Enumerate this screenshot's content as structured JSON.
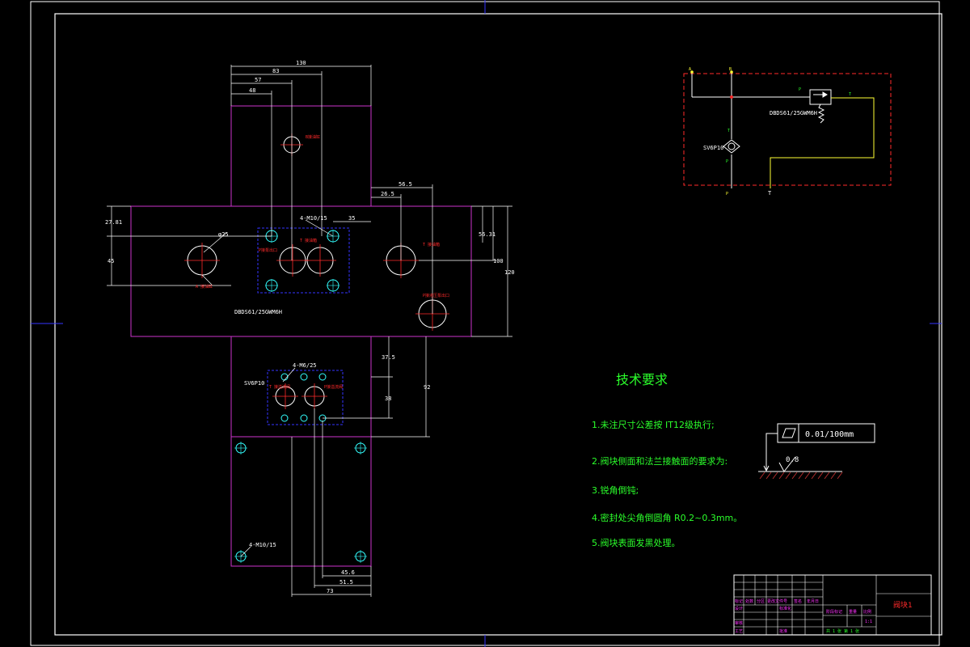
{
  "colors": {
    "background": "#000000",
    "frame": "#ffffff",
    "part_outline": "#cc33cc",
    "dimension": "#ffffff",
    "port_label": "#ff2a2a",
    "bolt_hole": "#33ffff",
    "hidden_rect": "#3333ff",
    "notes": "#2bff2b",
    "schematic_box": "#ff2a2a",
    "schematic_line": "#ffff33",
    "axis_marker": "#3333ff"
  },
  "dimensions": {
    "d130": "130",
    "d83": "83",
    "d57": "57",
    "d48": "48",
    "d565": "56.5",
    "d265": "26.5",
    "d35": "35",
    "d2781": "27.81",
    "d45": "45",
    "d5631": "56.31",
    "d100": "100",
    "d120": "120",
    "d375": "37.5",
    "d38": "38",
    "d92": "92",
    "d456": "45.6",
    "d515": "51.5",
    "d73": "73",
    "phi25": "φ25"
  },
  "labels": {
    "bolt_4m10": "4-M10/15",
    "bolt_4m6": "4-M6/25",
    "bolt_4m10_bottom": "4-M10/15",
    "valve_name": "DBDS61/25GWM6H",
    "valve_short": "SV6P10",
    "port_a_left": "A 接油缸",
    "port_p_left": "P接泵出口",
    "port_t_mid": "T 接油箱",
    "port_t_right": "T 接油箱",
    "port_p_right": "P接液压泵出口",
    "port_b_top": "B接油缸",
    "port_t_low": "T 接溢流阀",
    "port_p_low": "P接溢流阀"
  },
  "schematic": {
    "port_a": "A",
    "port_b": "B",
    "port_p_bottom": "P",
    "port_t_bottom": "T",
    "relief_p": "P",
    "relief_t": "T",
    "relief_name": "DBDS61/25GWM6H",
    "check_name": "SV6P10",
    "check_t": "T",
    "check_p": "P"
  },
  "notes": {
    "title": "技术要求",
    "items": [
      "1.未注尺寸公差按 IT12级执行;",
      "2.阀块侧面和法兰接触面的要求为:",
      "3.锐角倒钝;",
      "4.密封处尖角倒圆角 R0.2~0.3mm。",
      "5.阀块表面发黑处理。"
    ]
  },
  "tolerance": {
    "flatness": "0.01/100mm",
    "roughness": "0.8"
  },
  "title_block": {
    "drawing_name": "阀块1",
    "row1": [
      "标记",
      "处数",
      "分区",
      "更改文件号",
      "签名",
      "年月日"
    ],
    "row2": [
      "设计",
      "标准化"
    ],
    "stage": "阶段标记",
    "weight": "重量",
    "scale": "比例",
    "scale_value": "1:1",
    "check": "审核",
    "process": "工艺",
    "approve": "批准",
    "sheets": "共 1 张 第 1 张"
  }
}
